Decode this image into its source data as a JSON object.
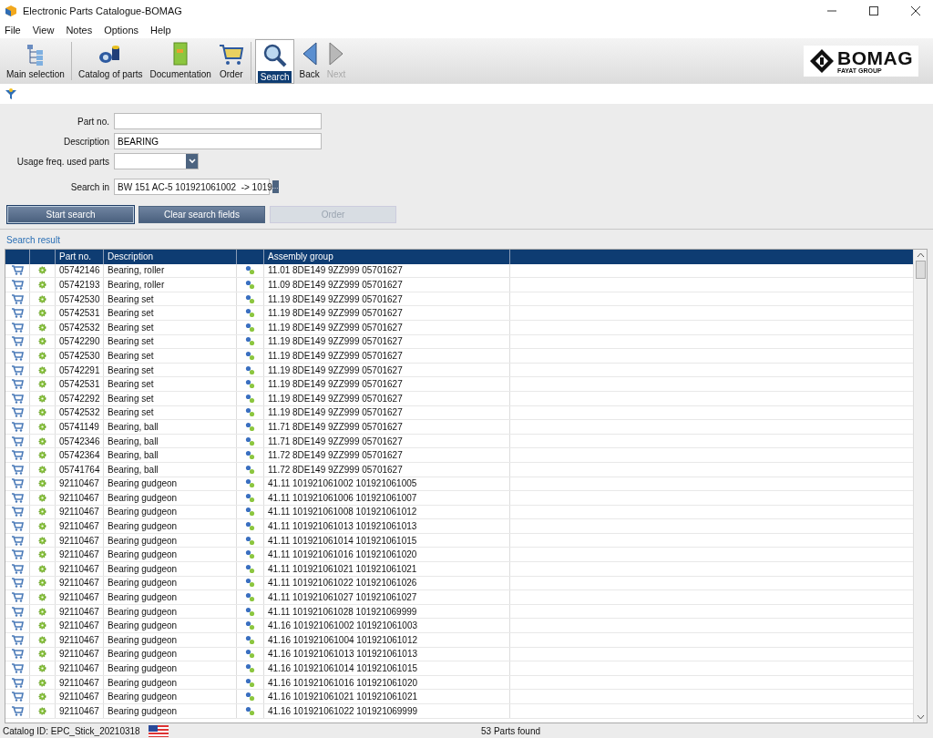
{
  "window": {
    "title": "Electronic Parts Catalogue-BOMAG"
  },
  "menu": [
    "File",
    "View",
    "Notes",
    "Options",
    "Help"
  ],
  "toolbar": [
    {
      "label": "Main selection",
      "kind": "tree",
      "selected": false,
      "disabled": false
    },
    {
      "label": "Catalog of parts",
      "kind": "parts",
      "selected": false,
      "disabled": false
    },
    {
      "label": "Documentation",
      "kind": "book",
      "selected": false,
      "disabled": false
    },
    {
      "label": "Order",
      "kind": "cart",
      "selected": false,
      "disabled": false
    },
    {
      "label": "Search",
      "kind": "search",
      "selected": true,
      "disabled": false
    },
    {
      "label": "Back",
      "kind": "back",
      "selected": false,
      "disabled": false
    },
    {
      "label": "Next",
      "kind": "next",
      "selected": false,
      "disabled": true
    }
  ],
  "logo": {
    "name": "BOMAG",
    "tagline": "FAYAT GROUP"
  },
  "form": {
    "fields": [
      {
        "label": "Part no.",
        "kind": "text"
      },
      {
        "label": "Description",
        "kind": "text",
        "value": "BEARING"
      },
      {
        "label": "Usage freq. used parts",
        "kind": "select"
      },
      {
        "label": "Search in",
        "kind": "browse",
        "value": "BW 151 AC-5 101921061002  -> 1019",
        "button": "..."
      }
    ],
    "buttons": [
      {
        "label": "Start search",
        "selected": true,
        "disabled": false
      },
      {
        "label": "Clear search fields",
        "selected": false,
        "disabled": false
      },
      {
        "label": "Order",
        "selected": false,
        "disabled": true
      }
    ]
  },
  "results": {
    "title": "Search result",
    "columns": [
      "Part no.",
      "Description",
      "Assembly group"
    ],
    "rows": [
      {
        "part_no": "05742146",
        "description": "Bearing, roller",
        "group": "11.01 8DE149 9ZZ999 05701627"
      },
      {
        "part_no": "05742193",
        "description": "Bearing, roller",
        "group": "11.09 8DE149 9ZZ999 05701627"
      },
      {
        "part_no": "05742530",
        "description": "Bearing set",
        "group": "11.19 8DE149 9ZZ999 05701627"
      },
      {
        "part_no": "05742531",
        "description": "Bearing set",
        "group": "11.19 8DE149 9ZZ999 05701627"
      },
      {
        "part_no": "05742532",
        "description": "Bearing set",
        "group": "11.19 8DE149 9ZZ999 05701627"
      },
      {
        "part_no": "05742290",
        "description": "Bearing set",
        "group": "11.19 8DE149 9ZZ999 05701627"
      },
      {
        "part_no": "05742530",
        "description": "Bearing set",
        "group": "11.19 8DE149 9ZZ999 05701627"
      },
      {
        "part_no": "05742291",
        "description": "Bearing set",
        "group": "11.19 8DE149 9ZZ999 05701627"
      },
      {
        "part_no": "05742531",
        "description": "Bearing set",
        "group": "11.19 8DE149 9ZZ999 05701627"
      },
      {
        "part_no": "05742292",
        "description": "Bearing set",
        "group": "11.19 8DE149 9ZZ999 05701627"
      },
      {
        "part_no": "05742532",
        "description": "Bearing set",
        "group": "11.19 8DE149 9ZZ999 05701627"
      },
      {
        "part_no": "05741149",
        "description": "Bearing, ball",
        "group": "11.71 8DE149 9ZZ999 05701627"
      },
      {
        "part_no": "05742346",
        "description": "Bearing, ball",
        "group": "11.71 8DE149 9ZZ999 05701627"
      },
      {
        "part_no": "05742364",
        "description": "Bearing, ball",
        "group": "11.72 8DE149 9ZZ999 05701627"
      },
      {
        "part_no": "05741764",
        "description": "Bearing, ball",
        "group": "11.72 8DE149 9ZZ999 05701627"
      },
      {
        "part_no": "92110467",
        "description": "Bearing gudgeon",
        "group": "41.11 101921061002 101921061005"
      },
      {
        "part_no": "92110467",
        "description": "Bearing gudgeon",
        "group": "41.11 101921061006 101921061007"
      },
      {
        "part_no": "92110467",
        "description": "Bearing gudgeon",
        "group": "41.11 101921061008 101921061012"
      },
      {
        "part_no": "92110467",
        "description": "Bearing gudgeon",
        "group": "41.11 101921061013 101921061013"
      },
      {
        "part_no": "92110467",
        "description": "Bearing gudgeon",
        "group": "41.11 101921061014 101921061015"
      },
      {
        "part_no": "92110467",
        "description": "Bearing gudgeon",
        "group": "41.11 101921061016 101921061020"
      },
      {
        "part_no": "92110467",
        "description": "Bearing gudgeon",
        "group": "41.11 101921061021 101921061021"
      },
      {
        "part_no": "92110467",
        "description": "Bearing gudgeon",
        "group": "41.11 101921061022 101921061026"
      },
      {
        "part_no": "92110467",
        "description": "Bearing gudgeon",
        "group": "41.11 101921061027 101921061027"
      },
      {
        "part_no": "92110467",
        "description": "Bearing gudgeon",
        "group": "41.11 101921061028 101921069999"
      },
      {
        "part_no": "92110467",
        "description": "Bearing gudgeon",
        "group": "41.16 101921061002 101921061003"
      },
      {
        "part_no": "92110467",
        "description": "Bearing gudgeon",
        "group": "41.16 101921061004 101921061012"
      },
      {
        "part_no": "92110467",
        "description": "Bearing gudgeon",
        "group": "41.16 101921061013 101921061013"
      },
      {
        "part_no": "92110467",
        "description": "Bearing gudgeon",
        "group": "41.16 101921061014 101921061015"
      },
      {
        "part_no": "92110467",
        "description": "Bearing gudgeon",
        "group": "41.16 101921061016 101921061020"
      },
      {
        "part_no": "92110467",
        "description": "Bearing gudgeon",
        "group": "41.16 101921061021 101921061021"
      },
      {
        "part_no": "92110467",
        "description": "Bearing gudgeon",
        "group": "41.16 101921061022 101921069999"
      }
    ]
  },
  "status_bar": {
    "catalog": "Catalog ID: EPC_Stick_20210318",
    "count": "53 Parts found"
  }
}
